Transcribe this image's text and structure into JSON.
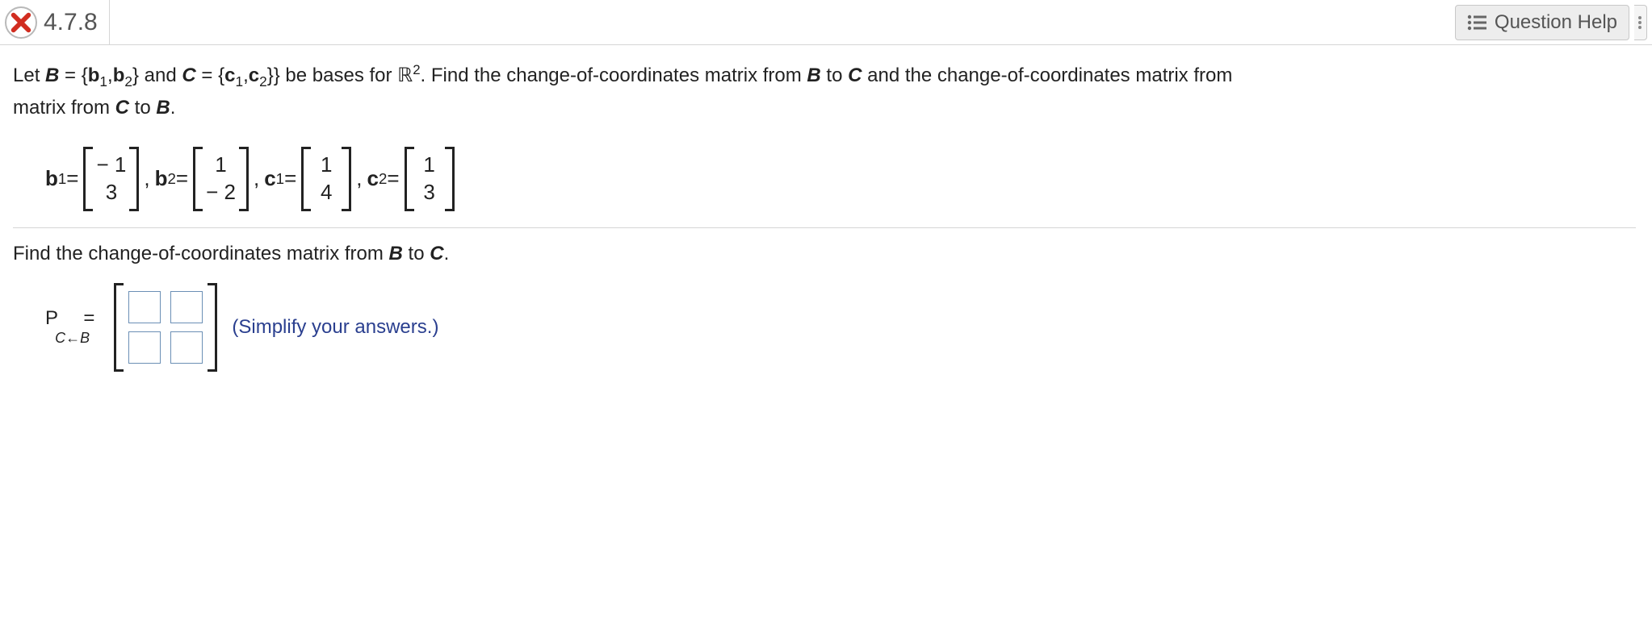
{
  "header": {
    "question_number": "4.7.8",
    "help_label": "Question Help",
    "status": "incorrect"
  },
  "problem": {
    "intro_a": "Let ",
    "B_eq": "B = {",
    "b1": "b",
    "b1_sub": "1",
    "comma": ",",
    "b2": "b",
    "b2_sub": "2",
    "close_and": "} and ",
    "C_eq": "C = {",
    "c1": "c",
    "c1_sub": "1",
    "c2": "c",
    "c2_sub": "2",
    "close_be": "} be bases for ",
    "R2": "ℝ",
    "R2_sup": "2",
    "tail": ". Find the change-of-coordinates matrix from ",
    "B": "B",
    "to": " to ",
    "C": "C",
    "tail2": " and the change-of-coordinates matrix from ",
    "tail3": ".",
    "line2": "matrix from C to B."
  },
  "vectors": {
    "b1_label": "b",
    "b1_sub": "1",
    "eq": " = ",
    "b1": [
      "− 1",
      "3"
    ],
    "b2_label": "b",
    "b2_sub": "2",
    "b2": [
      "1",
      "− 2"
    ],
    "c1_label": "c",
    "c1_sub": "1",
    "c1": [
      "1",
      "4"
    ],
    "c2_label": "c",
    "c2_sub": "2",
    "c2": [
      "1",
      "3"
    ]
  },
  "prompt2": "Find the change-of-coordinates matrix from B to C.",
  "answer": {
    "P": "P",
    "eq": "=",
    "sub": "C←B",
    "hint": "(Simplify your answers.)"
  },
  "chart_data": {
    "type": "table",
    "title": "Change-of-coordinates problem data",
    "basis_B": {
      "b1": [
        -1,
        3
      ],
      "b2": [
        1,
        -2
      ]
    },
    "basis_C": {
      "c1": [
        1,
        4
      ],
      "c2": [
        1,
        3
      ]
    },
    "requested": "P_{C<-B} (2x2 matrix, blank inputs)"
  }
}
